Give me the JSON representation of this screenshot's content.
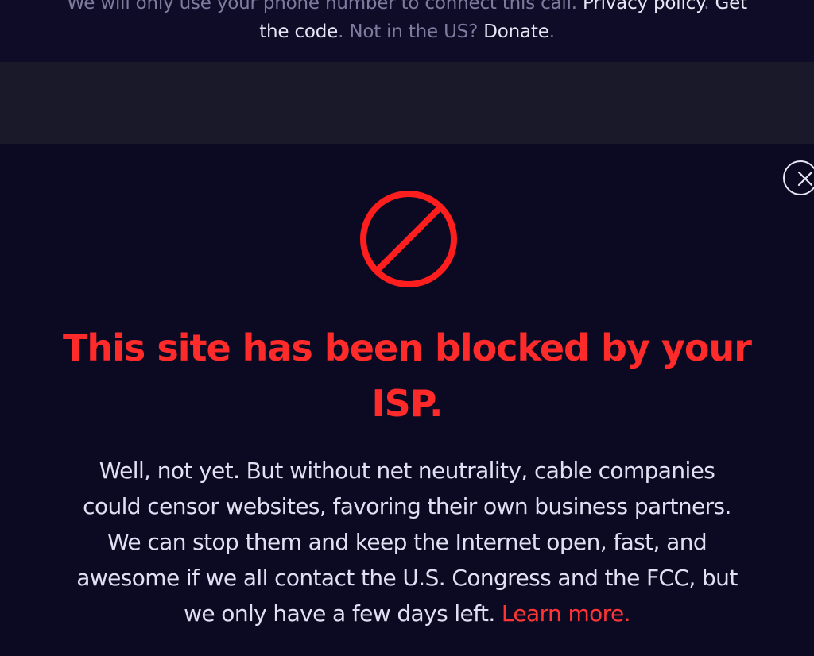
{
  "top_notice": {
    "text_part1": "We will only use your phone number to connect this call. ",
    "privacy_link": "Privacy policy",
    "sep1": ". ",
    "get_link_line1": "Get",
    "get_link_line2": "the code",
    "text_part2": ". Not in the US? ",
    "donate_link": "Donate",
    "end": "."
  },
  "modal": {
    "close_icon": "close-icon",
    "blocked_icon": "prohibited-icon",
    "accent_color": "#ff2a2a",
    "headline_line1": "This site has been blocked by your",
    "headline_line2": "ISP.",
    "body_line1": "Well, not yet. But without net neutrality, cable companies",
    "body_line2": "could censor websites, favoring their own business partners.",
    "body_line3": "We can stop them and keep the Internet open, fast, and",
    "body_line4": "awesome if we all contact the U.S. Congress and the FCC, but",
    "body_line5_text": "we only have a few days left. ",
    "learn_more_link": "Learn more."
  }
}
